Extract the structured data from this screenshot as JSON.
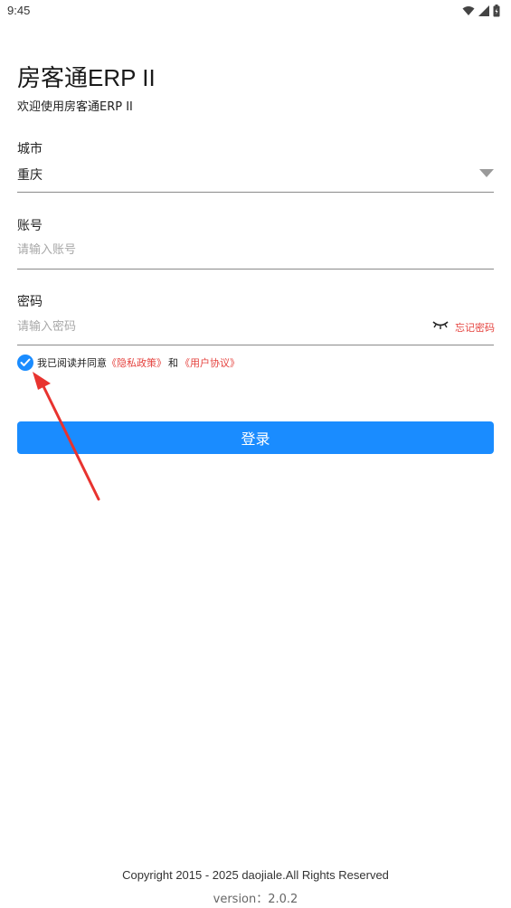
{
  "status_bar": {
    "time": "9:45"
  },
  "app": {
    "title": "房客通ERP II",
    "subtitle": "欢迎使用房客通ERP II"
  },
  "city": {
    "label": "城市",
    "value": "重庆"
  },
  "account": {
    "label": "账号",
    "placeholder": "请输入账号",
    "value": ""
  },
  "password": {
    "label": "密码",
    "placeholder": "请输入密码",
    "value": "",
    "forgot_label": "忘记密码"
  },
  "agreement": {
    "checked": true,
    "text": "我已阅读并同意",
    "privacy_link": "《隐私政策》",
    "conjunction": "和",
    "terms_link": "《用户协议》"
  },
  "login_button": {
    "label": "登录"
  },
  "footer": {
    "copyright": "Copyright 2015 - 2025 daojiale.All Rights Reserved",
    "version": "version：2.0.2"
  },
  "icons": [
    "wifi-icon",
    "signal-icon",
    "battery-icon",
    "chevron-down-icon",
    "eye-closed-icon",
    "check-icon"
  ],
  "colors": {
    "primary": "#1a8cff",
    "link": "#e5433f",
    "annotation_arrow": "#e8332f"
  }
}
